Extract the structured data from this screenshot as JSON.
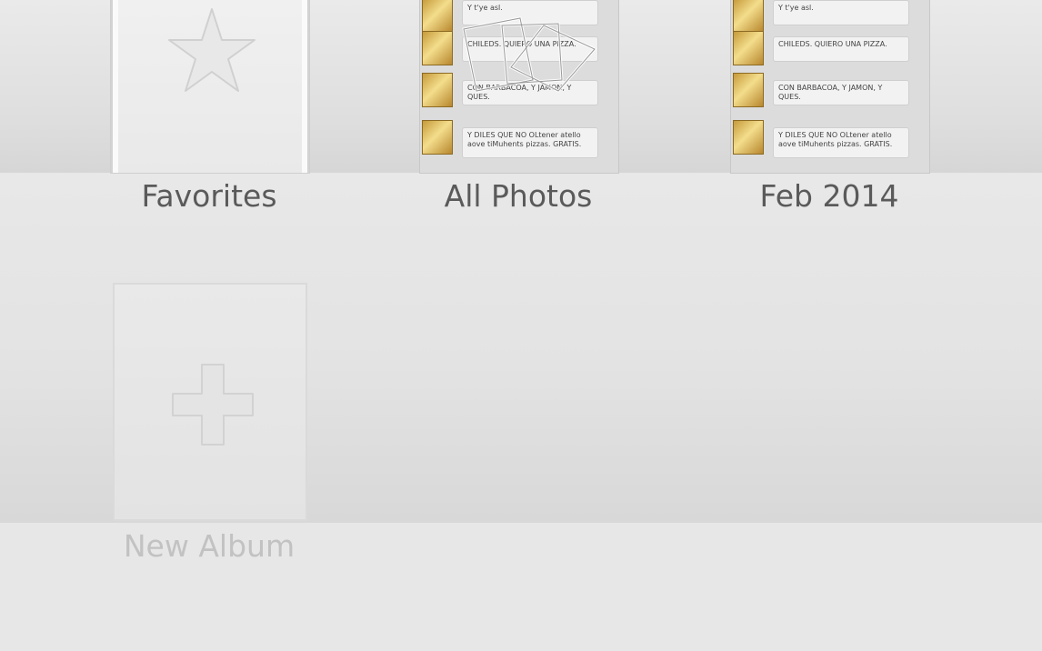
{
  "albums": [
    {
      "label": "Favorites"
    },
    {
      "label": "All Photos"
    },
    {
      "label": "Feb 2014"
    }
  ],
  "new_album": {
    "label": "New Album"
  },
  "thumbnail_chat": {
    "messages": [
      "Y t'ye asl.",
      "CHILEDS. QUIERO UNA PIZZA.",
      "CON BARBACOA, Y JAMON, Y QUES.",
      "Y DILES QUE NO OLtener atello aove tiMuhents pizzas. GRATIS."
    ]
  },
  "icons": {
    "favorites": "star-icon",
    "all_photos": "stacked-photos-icon",
    "new_album": "plus-icon"
  },
  "colors": {
    "label": "#5a5a5a",
    "label_disabled": "#c2c2c2",
    "background": "#e6e6e6"
  }
}
